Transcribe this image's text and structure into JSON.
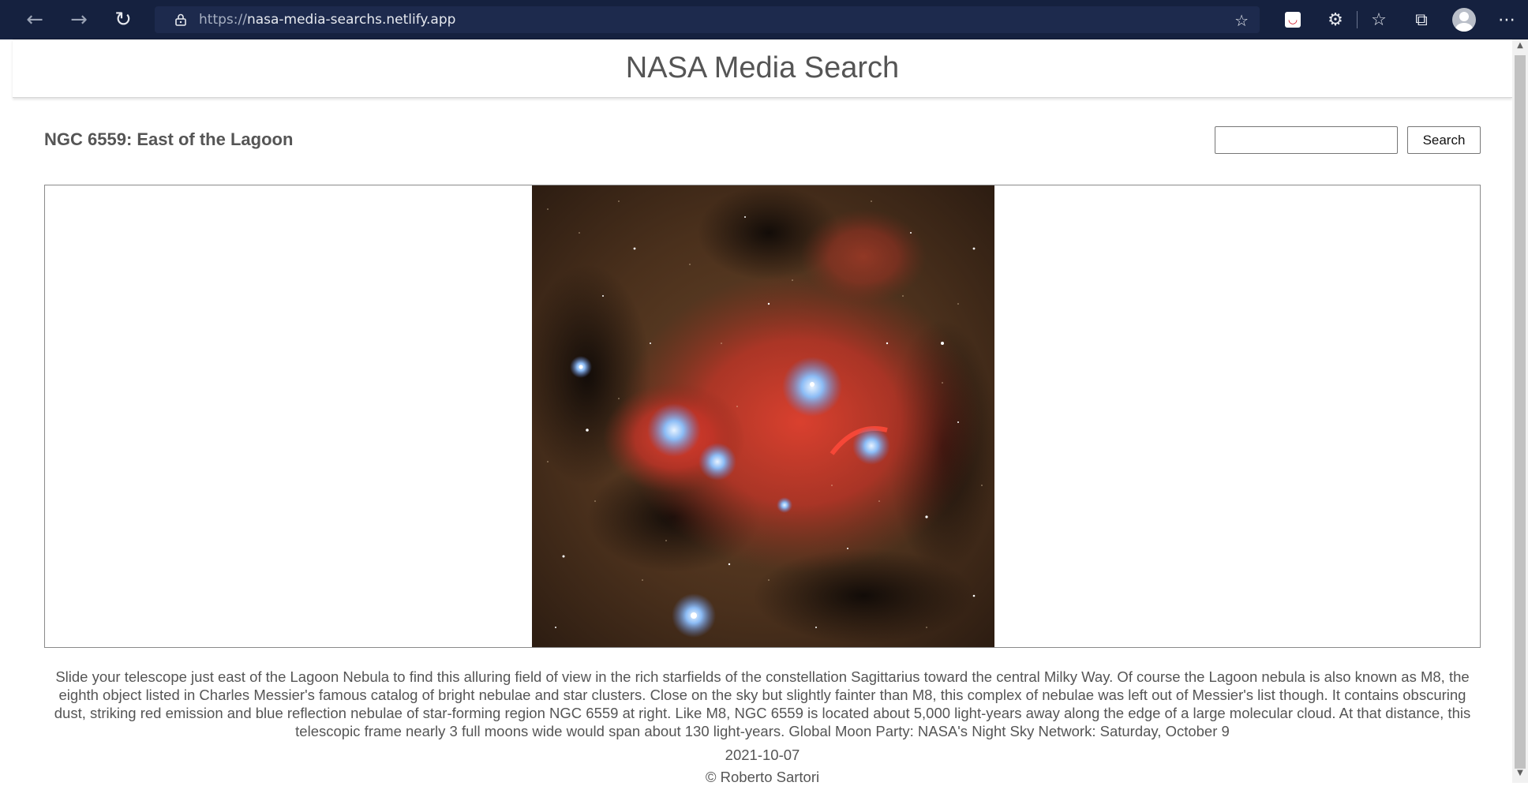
{
  "browser": {
    "url_protocol": "https://",
    "url_host": "nasa-media-searchs.netlify.app",
    "back_icon": "back-arrow-icon",
    "forward_icon": "forward-arrow-icon",
    "refresh_icon": "refresh-icon",
    "toolbar_icons": [
      "add-favorite-icon",
      "pocket-icon",
      "extensions-icon",
      "favorites-icon",
      "collections-icon",
      "profile-avatar",
      "more-icon"
    ]
  },
  "site": {
    "title": "NASA Media Search"
  },
  "item": {
    "title": "NGC 6559: East of the Lagoon",
    "description": "Slide your telescope just east of the Lagoon Nebula to find this alluring field of view in the rich starfields of the constellation Sagittarius toward the central Milky Way. Of course the Lagoon nebula is also known as M8, the eighth object listed in Charles Messier's famous catalog of bright nebulae and star clusters. Close on the sky but slightly fainter than M8, this complex of nebulae was left out of Messier's list though. It contains obscuring dust, striking red emission and blue reflection nebulae of star-forming region NGC 6559 at right. Like M8, NGC 6559 is located about 5,000 light-years away along the edge of a large molecular cloud. At that distance, this telescopic frame nearly 3 full moons wide would span about 130 light-years. Global Moon Party: NASA's Night Sky Network: Saturday, October 9",
    "date": "2021-10-07",
    "copyright": "© Roberto Sartori"
  },
  "search": {
    "value": "",
    "placeholder": "",
    "button_label": "Search"
  },
  "colors": {
    "browser_bg": "#15213f",
    "text": "#555555",
    "nebula_red": "#d0352a",
    "nebula_blue": "#7fb4f0"
  }
}
